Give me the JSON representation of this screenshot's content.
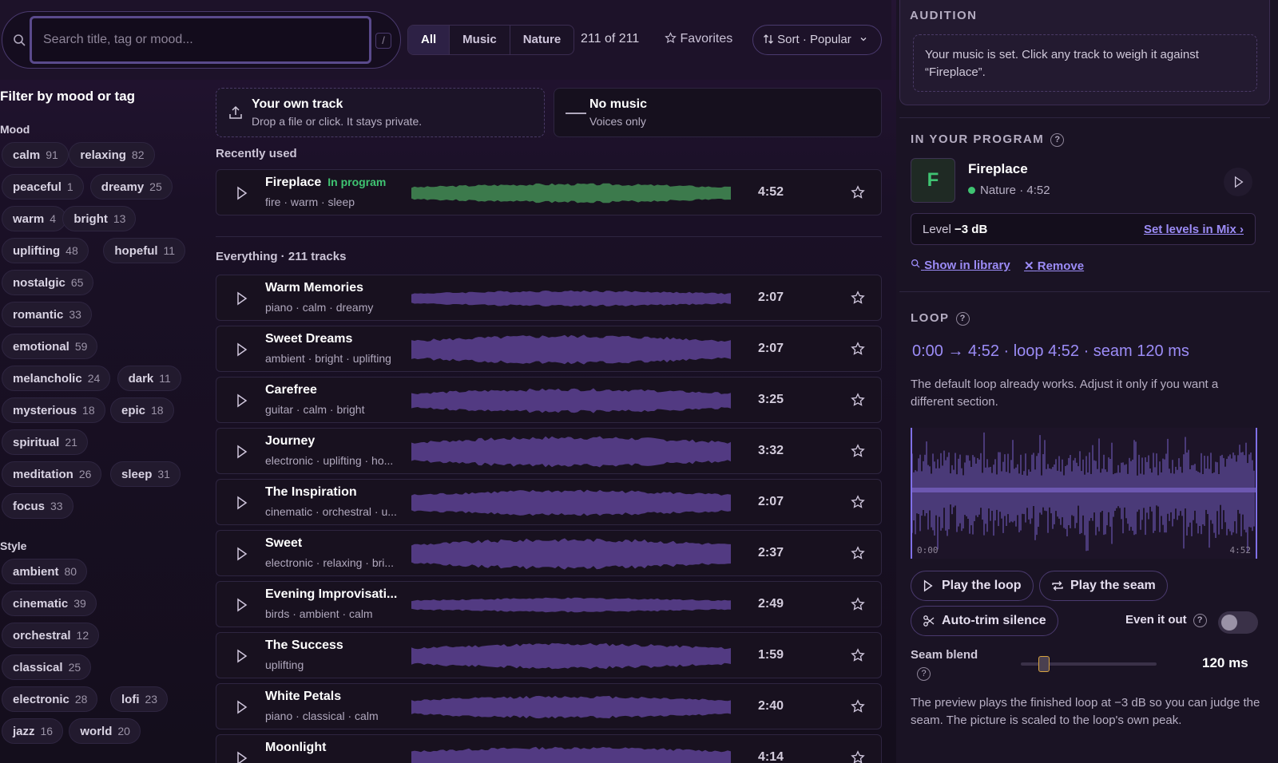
{
  "search": {
    "placeholder": "Search title, tag or mood...",
    "shortcut": "/"
  },
  "tabs": [
    "All",
    "Music",
    "Nature"
  ],
  "count_text": "211 of 211",
  "favorites_label": "Favorites",
  "sort_label": "Sort · Popular",
  "filters": {
    "title": "Filter by mood or tag",
    "mood_label": "Mood",
    "mood": [
      {
        "tag": "calm",
        "count": "91"
      },
      {
        "tag": "relaxing",
        "count": "82"
      },
      {
        "tag": "peaceful",
        "count": "1"
      },
      {
        "tag": "dreamy",
        "count": "25"
      },
      {
        "tag": "warm",
        "count": "4"
      },
      {
        "tag": "bright",
        "count": "13"
      },
      {
        "tag": "uplifting",
        "count": "48"
      },
      {
        "tag": "hopeful",
        "count": "11"
      },
      {
        "tag": "nostalgic",
        "count": "65"
      },
      {
        "tag": "romantic",
        "count": "33"
      },
      {
        "tag": "emotional",
        "count": "59"
      },
      {
        "tag": "melancholic",
        "count": "24"
      },
      {
        "tag": "dark",
        "count": "11"
      },
      {
        "tag": "mysterious",
        "count": "18"
      },
      {
        "tag": "epic",
        "count": "18"
      },
      {
        "tag": "spiritual",
        "count": "21"
      },
      {
        "tag": "meditation",
        "count": "26"
      },
      {
        "tag": "sleep",
        "count": "31"
      },
      {
        "tag": "focus",
        "count": "33"
      }
    ],
    "style_label": "Style",
    "style": [
      {
        "tag": "ambient",
        "count": "80"
      },
      {
        "tag": "cinematic",
        "count": "39"
      },
      {
        "tag": "orchestral",
        "count": "12"
      },
      {
        "tag": "classical",
        "count": "25"
      },
      {
        "tag": "electronic",
        "count": "28"
      },
      {
        "tag": "lofi",
        "count": "23"
      },
      {
        "tag": "jazz",
        "count": "16"
      },
      {
        "tag": "world",
        "count": "20"
      }
    ]
  },
  "own_track": {
    "title": "Your own track",
    "subtitle": "Drop a file or click. It stays private."
  },
  "no_music": {
    "title": "No music",
    "subtitle": "Voices only"
  },
  "recent_label": "Recently used",
  "recent": {
    "name": "Fireplace",
    "badge": "In program",
    "tags": "fire · warm · sleep",
    "duration": "4:52"
  },
  "all_label": "Everything · 211 tracks",
  "tracks": [
    {
      "name": "Warm Memories",
      "tags": "piano · calm · dreamy",
      "duration": "2:07"
    },
    {
      "name": "Sweet Dreams",
      "tags": "ambient · bright · uplifting",
      "duration": "2:07"
    },
    {
      "name": "Carefree",
      "tags": "guitar · calm · bright",
      "duration": "3:25"
    },
    {
      "name": "Journey",
      "tags": "electronic · uplifting · ho...",
      "duration": "3:32"
    },
    {
      "name": "The Inspiration",
      "tags": "cinematic · orchestral · u...",
      "duration": "2:07"
    },
    {
      "name": "Sweet",
      "tags": "electronic · relaxing · bri...",
      "duration": "2:37"
    },
    {
      "name": "Evening Improvisati...",
      "tags": "birds · ambient · calm",
      "duration": "2:49"
    },
    {
      "name": "The Success",
      "tags": "uplifting",
      "duration": "1:59"
    },
    {
      "name": "White Petals",
      "tags": "piano · classical · calm",
      "duration": "2:40"
    },
    {
      "name": "Moonlight",
      "tags": "",
      "duration": "4:14"
    }
  ],
  "audition": {
    "title": "AUDITION",
    "message": "Your music is set. Click any track to weigh it against “Fireplace”."
  },
  "program": {
    "title": "IN YOUR PROGRAM",
    "help": "?",
    "avatar": "F",
    "name": "Fireplace",
    "meta": "Nature · 4:52",
    "level_label": "Level",
    "level_value": "−3 dB",
    "set_levels": "Set levels in Mix",
    "show_in_library": "Show in library",
    "remove": "Remove"
  },
  "loop": {
    "title": "LOOP",
    "help": "?",
    "summary": "0:00 → 4:52 · loop 4:52 · seam 120 ms",
    "hint": "The default loop already works. Adjust it only if you want a different section.",
    "start": "0:00",
    "end": "4:52",
    "play_loop": "Play the loop",
    "play_seam": "Play the seam",
    "auto_trim": "Auto-trim silence",
    "even_label": "Even it out",
    "even_on": false,
    "seam_label": "Seam blend",
    "seam_value": "120 ms",
    "seam_level": 0.16,
    "footnote": "The preview plays the finished loop at −3 dB so you can judge the seam. The picture is scaled to the loop's own peak."
  },
  "colors": {
    "accent": "#9c8cf7",
    "green": "#3fc472",
    "wave": "#5a3e8c"
  }
}
